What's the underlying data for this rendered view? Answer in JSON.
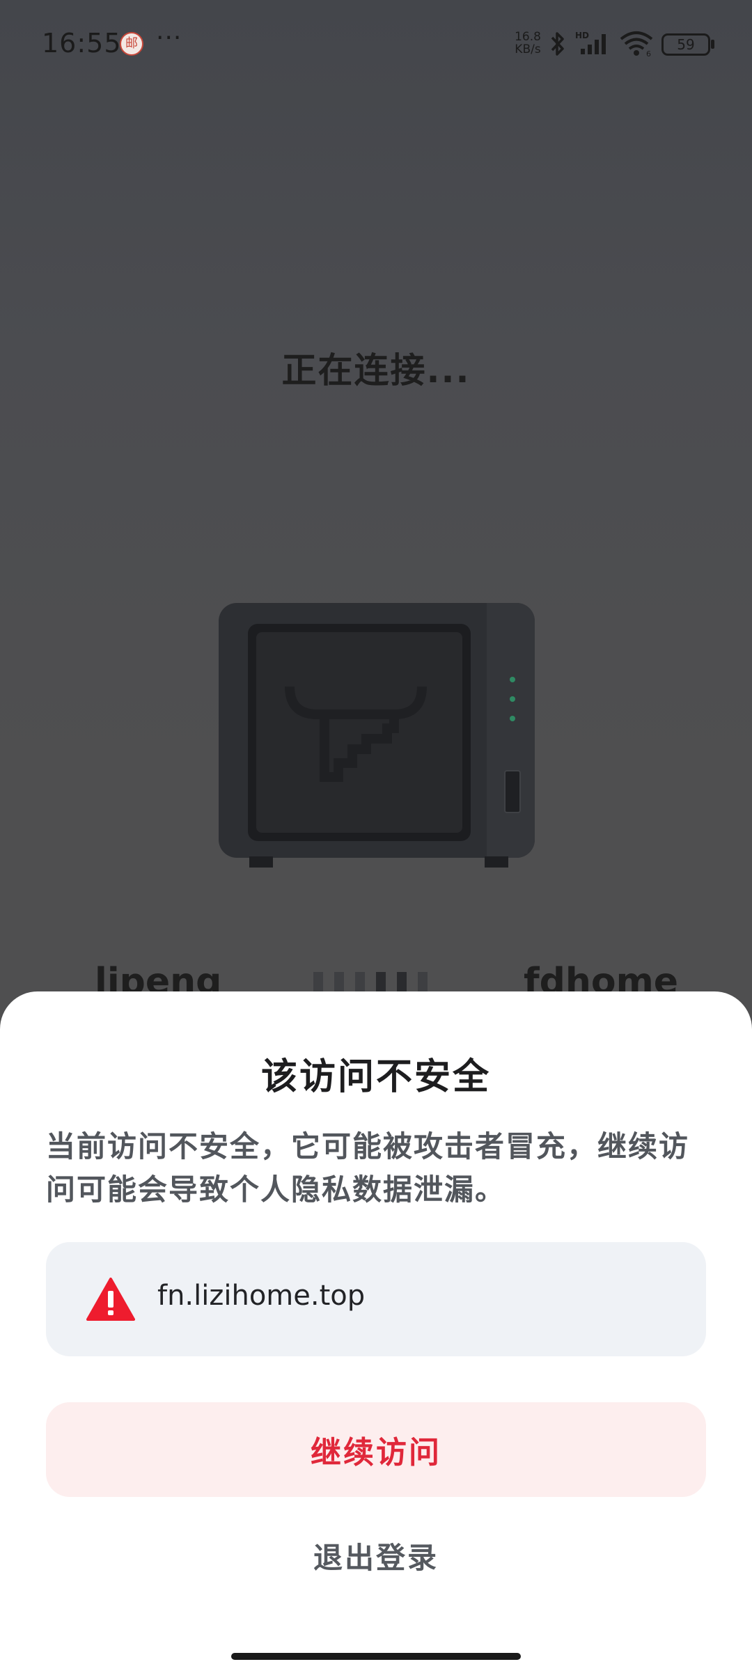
{
  "status_bar": {
    "time": "16:55",
    "notification_glyph": "邮",
    "more": "···",
    "net_speed_value": "16.8",
    "net_speed_unit": "KB/s",
    "network_label": "HD",
    "wifi_label": "6",
    "battery": "59"
  },
  "main": {
    "connecting_text": "正在连接...",
    "from_name": "lipeng",
    "to_name": "fdhome"
  },
  "dialog": {
    "title": "该访问不安全",
    "description": "当前访问不安全，它可能被攻击者冒充，继续访问可能会导致个人隐私数据泄漏。",
    "url": "fn.lizihome.top",
    "continue_label": "继续访问",
    "logout_label": "退出登录"
  },
  "colors": {
    "danger": "#e0283a",
    "sheet_bg": "#ffffff",
    "url_box_bg": "#eff2f6"
  }
}
